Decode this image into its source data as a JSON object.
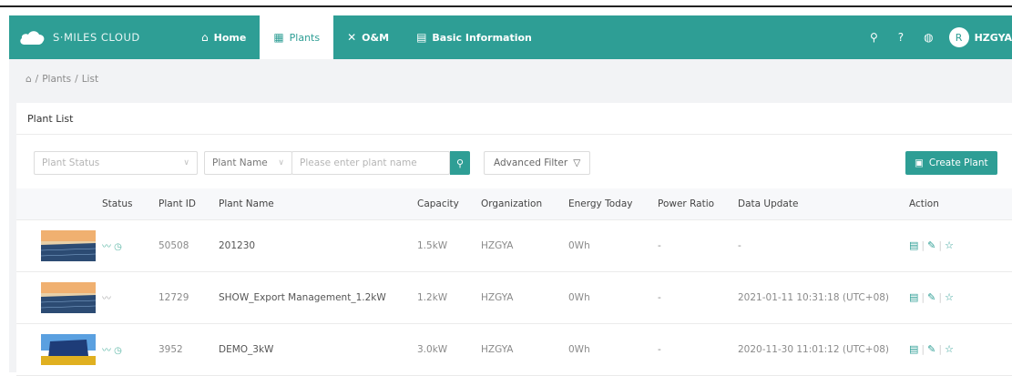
{
  "app": {
    "brand": "S·MILES CLOUD"
  },
  "nav": {
    "items": [
      {
        "label": "Home",
        "icon": "home-icon",
        "active": false
      },
      {
        "label": "Plants",
        "icon": "plants-icon",
        "active": true
      },
      {
        "label": "O&M",
        "icon": "tools-icon",
        "active": false
      },
      {
        "label": "Basic Information",
        "icon": "document-icon",
        "active": false
      }
    ],
    "user": {
      "avatar_letter": "R",
      "name": "HZGYA"
    }
  },
  "breadcrumb": {
    "home": "⌂",
    "sep": "/",
    "items": [
      "Plants",
      "List"
    ]
  },
  "card": {
    "title": "Plant List"
  },
  "filters": {
    "status_placeholder": "Plant Status",
    "name_field": "Plant Name",
    "name_placeholder": "Please enter plant name",
    "advanced": "Advanced Filter",
    "create": "Create Plant"
  },
  "table": {
    "headers": [
      "",
      "Status",
      "Plant ID",
      "Plant Name",
      "Capacity",
      "Organization",
      "Energy Today",
      "Power Ratio",
      "Data Update",
      "Action"
    ],
    "rows": [
      {
        "thumb": "solar-panel-dusk",
        "status": "online",
        "id": "50508",
        "name": "201230",
        "capacity": "1.5kW",
        "org": "HZGYA",
        "energy": "0Wh",
        "ratio": "-",
        "update": "-"
      },
      {
        "thumb": "solar-panel-dusk",
        "status": "offline",
        "id": "12729",
        "name": "SHOW_Export Management_1.2kW",
        "capacity": "1.2kW",
        "org": "HZGYA",
        "energy": "0Wh",
        "ratio": "-",
        "update": "2021-01-11 10:31:18 (UTC+08)"
      },
      {
        "thumb": "solar-panel-field",
        "status": "online",
        "id": "3952",
        "name": "DEMO_3kW",
        "capacity": "3.0kW",
        "org": "HZGYA",
        "energy": "0Wh",
        "ratio": "-",
        "update": "2020-11-30 11:01:12 (UTC+08)"
      }
    ]
  },
  "colors": {
    "accent": "#2e9e95",
    "status_online": "#5fb8a8",
    "status_offline": "#b0b0b0"
  }
}
